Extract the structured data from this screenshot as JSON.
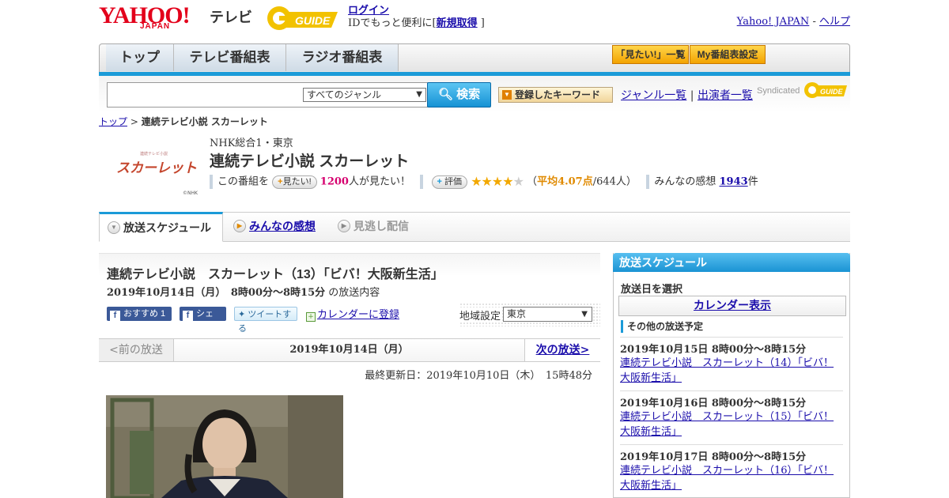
{
  "header": {
    "logo_main": "YAHOO!",
    "logo_sub": "JAPAN",
    "logo_tv": "テレビ",
    "gguide_logo": "G GUIDE",
    "login_link": "ログイン",
    "login_text_pre": "IDでもっと便利に[",
    "signup_link": "新規取得",
    "login_text_post": "]",
    "yahoo_japan_link": "Yahoo! JAPAN",
    "link_separator": "-",
    "help_link": "ヘルプ"
  },
  "nav": {
    "tabs": [
      {
        "label": "トップ"
      },
      {
        "label": "テレビ番組表"
      },
      {
        "label": "ラジオ番組表"
      }
    ],
    "buttons": [
      {
        "label": "「見たい!」一覧"
      },
      {
        "label": "My番組表設定"
      }
    ]
  },
  "search": {
    "input_value": "",
    "genre_selected": "すべてのジャンル",
    "search_button": "検索",
    "keyword_button": "登録したキーワード",
    "genre_list_link": "ジャンル一覧",
    "links_separator": "|",
    "performer_list_link": "出演者一覧",
    "syndicated": "Syndicated"
  },
  "breadcrumb": {
    "top_link": "トップ",
    "separator": ">",
    "current": "連続テレビ小説 スカーレット"
  },
  "program": {
    "image_text": "スカーレット",
    "image_small_text": "連続テレビ小説",
    "image_credit": "©NHK",
    "channel": "NHK総合1・東京",
    "title": "連続テレビ小説 スカーレット",
    "want_prefix": "この番組を",
    "want_button": "見たい!",
    "want_count": "1200",
    "want_suffix": "人が見たい！",
    "rate_button": "評価",
    "rating_value": 4.07,
    "rating_text_pre": "（",
    "rating_avg": "平均4.07点",
    "rating_count": "/644人）",
    "reviews_label": "みんなの感想",
    "reviews_count": "1943",
    "reviews_suffix": "件"
  },
  "tabs": [
    {
      "label": "放送スケジュール",
      "active": true
    },
    {
      "label": "みんなの感想",
      "active": false
    },
    {
      "label": "見逃し配信",
      "active": false
    }
  ],
  "episode": {
    "title": "連続テレビ小説　スカーレット（13）「ビバ！大阪新生活」",
    "datetime": "2019年10月14日（月）　8時00分～8時15分",
    "datetime_suffix": "の放送内容",
    "recommend_button": "おすすめ 1",
    "share_button": "シェア",
    "tweet_button": "ツイートする",
    "calendar_link": "カレンダーに登録",
    "region_label": "地域設定",
    "region_selected": "東京",
    "prev_broadcast": "<前の放送",
    "current_date": "2019年10月14日（月）",
    "next_broadcast": "次の放送>",
    "last_updated": "最終更新日：2019年10月10日（木）　15時48分"
  },
  "sidebar": {
    "title": "放送スケジュール",
    "select_date_label": "放送日を選択",
    "calendar_button": "カレンダー表示",
    "other_schedule_label": "その他の放送予定",
    "items": [
      {
        "date": "2019年10月15日  8時00分～8時15分",
        "title": "連続テレビ小説　スカーレット（14）「ビバ！大阪新生活」"
      },
      {
        "date": "2019年10月16日  8時00分～8時15分",
        "title": "連続テレビ小説　スカーレット（15）「ビバ！大阪新生活」"
      },
      {
        "date": "2019年10月17日  8時00分～8時15分",
        "title": "連続テレビ小説　スカーレット（16）「ビバ！大阪新生活」"
      }
    ]
  },
  "colors": {
    "accent_blue": "#1b9bd8",
    "yahoo_red": "#e3001b",
    "link": "#1a0dab",
    "want_pink": "#d6006f",
    "rating_orange": "#e08a00"
  }
}
